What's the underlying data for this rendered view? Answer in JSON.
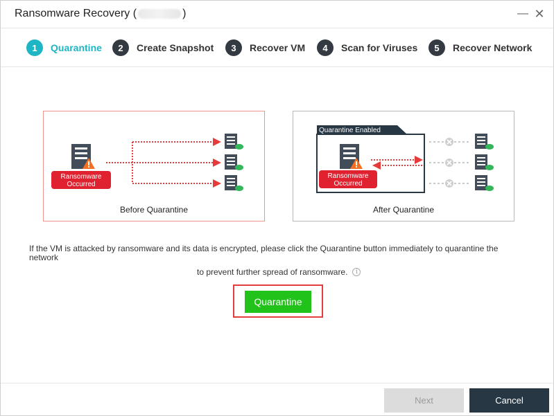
{
  "window": {
    "title_prefix": "Ransomware Recovery (",
    "title_suffix": ")",
    "minimize_glyph": "—",
    "close_glyph": "✕"
  },
  "steps": [
    {
      "num": "1",
      "label": "Quarantine",
      "active": true
    },
    {
      "num": "2",
      "label": "Create Snapshot",
      "active": false
    },
    {
      "num": "3",
      "label": "Recover VM",
      "active": false
    },
    {
      "num": "4",
      "label": "Scan for Viruses",
      "active": false
    },
    {
      "num": "5",
      "label": "Recover Network",
      "active": false
    }
  ],
  "before": {
    "badge_line1": "Ransomware",
    "badge_line2": "Occurred",
    "caption": "Before Quarantine"
  },
  "after": {
    "tag": "Quarantine Enabled",
    "badge_line1": "Ransomware",
    "badge_line2": "Occurred",
    "caption": "After Quarantine"
  },
  "description": {
    "line1": "If the VM is attacked by ransomware and its data is encrypted, please click the Quarantine button immediately to quarantine the network",
    "line2": "to prevent further spread of ransomware.",
    "info_glyph": "i"
  },
  "actions": {
    "quarantine_label": "Quarantine",
    "next_label": "Next",
    "cancel_label": "Cancel"
  },
  "colors": {
    "accent": "#1eb5c4",
    "step_inactive": "#333a42",
    "danger": "#e0212f",
    "warning": "#f36f21",
    "server_dark": "#434d5a",
    "cloud_green": "#33b75a",
    "arrow_red": "#e63b3b",
    "quarantine_green": "#21c21a",
    "cancel_navy": "#273744"
  }
}
